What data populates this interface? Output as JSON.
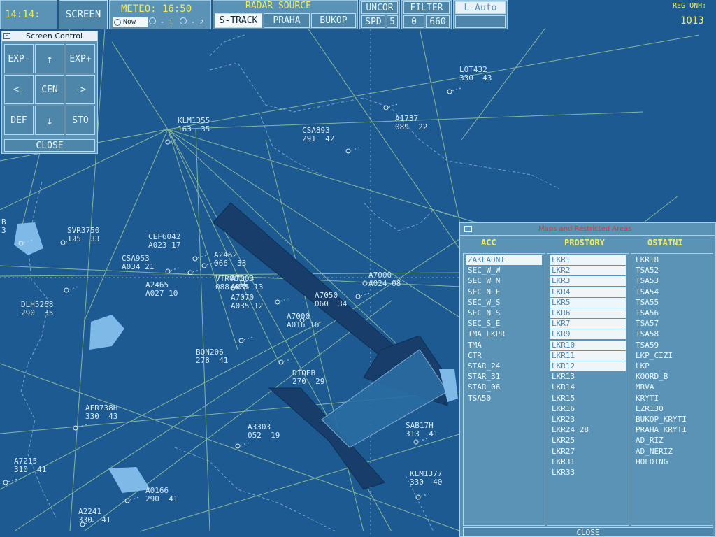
{
  "toolbar": {
    "clock": "14:14:",
    "screen": "SCREEN",
    "meteo": "METEO: 16:50",
    "now": "Now",
    "minus1": "- 1",
    "minus2": "- 2",
    "radar_source": "RADAR SOURCE",
    "strack": "S-TRACK",
    "praha": "PRAHA",
    "bukop": "BUKOP",
    "uncor": "UNCOR",
    "filter": "FILTER",
    "lauto": "L-Auto",
    "spd": "SPD",
    "spd_val": "5",
    "filter_lo": "0",
    "filter_hi": "660",
    "reg_qnh": "REG QNH:",
    "qnh": "1013"
  },
  "screen_control": {
    "title": "Screen Control",
    "exp_minus": "EXP-",
    "up": "↑",
    "exp_plus": "EXP+",
    "left": "<-",
    "cen": "CEN",
    "right": "->",
    "def": "DEF",
    "down": "↓",
    "sto": "STO",
    "close": "CLOSE"
  },
  "tracks": [
    {
      "l1": "KLM1355",
      "l2": "163  35"
    },
    {
      "l1": "CSA893",
      "l2": "291  42"
    },
    {
      "l1": "A1737",
      "l2": "089  22"
    },
    {
      "l1": "LOT432",
      "l2": "330  43"
    },
    {
      "l1": "SVR3750",
      "l2": "135  33"
    },
    {
      "l1": "CEF6042",
      "l2": "A023 17"
    },
    {
      "l1": "CSA953",
      "l2": "A034 21"
    },
    {
      "l1": "A2462",
      "l2": "066  33"
    },
    {
      "l1": "A2465",
      "l2": "A027 10"
    },
    {
      "l1": "VTR001",
      "l2": "088 A28"
    },
    {
      "l1": "A7003",
      "l2": "A035 13"
    },
    {
      "l1": "A7070",
      "l2": "A035 12"
    },
    {
      "l1": "A7050",
      "l2": "060  34"
    },
    {
      "l1": "A7000",
      "l2": "A024 08"
    },
    {
      "l1": "A7000",
      "l2": "A016 16"
    },
    {
      "l1": "DLH5268",
      "l2": "290  35"
    },
    {
      "l1": "BON206",
      "l2": "278  41"
    },
    {
      "l1": "DIOEB",
      "l2": "270  29"
    },
    {
      "l1": "AFR738H",
      "l2": "330  43"
    },
    {
      "l1": "A3303",
      "l2": "052  19"
    },
    {
      "l1": "SAB17H",
      "l2": "313  41"
    },
    {
      "l1": "A7215",
      "l2": "310  41"
    },
    {
      "l1": "A0166",
      "l2": "290  41"
    },
    {
      "l1": "KLM1377",
      "l2": "330  40"
    },
    {
      "l1": "A2241",
      "l2": "330  41"
    },
    {
      "l1": "B",
      "l2": "3"
    }
  ],
  "maps_panel": {
    "title": "Maps and Restricted Areas",
    "col_acc": "ACC",
    "col_prostory": "PROSTORY",
    "col_ostatni": "OSTATNI",
    "acc": [
      "ZAKLADNI",
      "SEC_W_W",
      "SEC_W_N",
      "SEC_N_E",
      "SEC_W_S",
      "SEC_N_S",
      "SEC_S_E",
      "TMA_LKPR",
      "TMA",
      "CTR",
      "STAR_24",
      "STAR_31",
      "STAR_06",
      "TSA50"
    ],
    "prostory": [
      "LKR1",
      "LKR2",
      "LKR3",
      "LKR4",
      "LKR5",
      "LKR6",
      "LKR7",
      "LKR9",
      "LKR10",
      "LKR11",
      "LKR12",
      "LKR13",
      "LKR14",
      "LKR15",
      "LKR16",
      "LKR23",
      "LKR24_28",
      "LKR25",
      "LKR27",
      "LKR31",
      "LKR33"
    ],
    "ostatni": [
      "LKR18",
      "TSA52",
      "TSA53",
      "TSA54",
      "TSA55",
      "TSA56",
      "TSA57",
      "TSA58",
      "TSA59",
      "LKP_CIZI",
      "LKP",
      "KOORD_B",
      "MRVA",
      "KRYTI",
      "LZR130",
      "BUKOP_KRYTI",
      "PRAHA_KRYTI",
      "AD_RIZ",
      "AD_NERIZ",
      "HOLDING"
    ],
    "close": "CLOSE"
  }
}
